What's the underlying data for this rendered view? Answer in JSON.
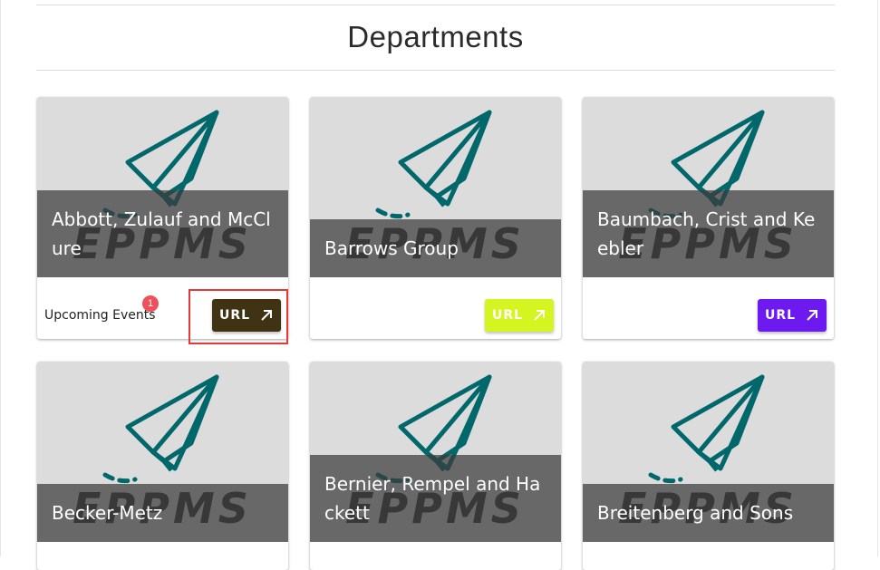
{
  "page": {
    "title": "Departments"
  },
  "logo_text": "EPPMS",
  "cards": [
    {
      "name": "Abbott, Zulauf and McClure",
      "button_label": "URL",
      "button_color": "#3f3314",
      "button_text_color": "#ffffff",
      "upcoming_label": "Upcoming Events",
      "upcoming_count": "1"
    },
    {
      "name": "Barrows Group",
      "button_label": "URL",
      "button_color": "#d4f51f",
      "button_text_color": "#ffffff"
    },
    {
      "name": "Baumbach, Crist and Keebler",
      "button_label": "URL",
      "button_color": "#6d1af0",
      "button_text_color": "#ffffff"
    },
    {
      "name": "Becker-Metz"
    },
    {
      "name": "Bernier, Rempel and Hackett"
    },
    {
      "name": "Breitenberg and Sons"
    }
  ],
  "colors": {
    "plane": "#00676b",
    "overlay": "#3c3c3c",
    "highlight": "#e53935"
  }
}
